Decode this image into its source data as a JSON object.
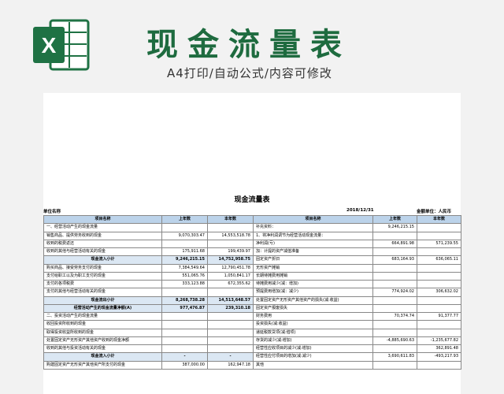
{
  "header": {
    "title": "现金流量表",
    "subtitle": "A4打印/自动公式/内容可修改",
    "icon_letter": "X"
  },
  "colors": {
    "brand": "#1e6b3f",
    "excel_green": "#1f7244",
    "table_header": "#bcd3ea"
  },
  "sheet": {
    "title": "现金流量表",
    "unit_label": "单位名称",
    "date": "2018/12/31",
    "currency": "金额单位：人民币",
    "columns": [
      "项目名称",
      "上年数",
      "本年数",
      "项目名称",
      "上年数",
      "本年数"
    ],
    "rows": [
      {
        "l": "一、经营活动产生的现金流量",
        "lp": "",
        "lc": "",
        "r": "补充资料：",
        "rp": "9,246,215.15",
        "rc": ""
      },
      {
        "l": "销售商品、提供劳务收到的现金",
        "lp": "9,070,303.47",
        "lc": "14,553,518.78",
        "r": "1、将净利润调节为经营活动现金流量：",
        "rp": "",
        "rc": ""
      },
      {
        "l": "收到的税费返还",
        "lp": "",
        "lc": "",
        "r": "净利润(亏)",
        "rp": "664,891.98",
        "rc": "571,239.55"
      },
      {
        "l": "收到的其他与经营活动有关的现金",
        "lp": "175,911.68",
        "lc": "199,439.97",
        "r": "加：计提的资产减值准备",
        "rp": "",
        "rc": ""
      },
      {
        "l": "现金流入小计",
        "lp": "9,246,215.15",
        "lc": "14,752,958.75",
        "r": "固定资产折旧",
        "rp": "683,164.93",
        "rc": "636,065.11",
        "sub": true
      },
      {
        "l": "购买商品、接受劳务支付的现金",
        "lp": "7,384,549.64",
        "lc": "12,790,451.78",
        "r": "无形资产摊销",
        "rp": "",
        "rc": ""
      },
      {
        "l": "支付给职工以及为职工支付的现金",
        "lp": "551,065.76",
        "lc": "1,050,841.17",
        "r": "长期待摊费用摊销",
        "rp": "",
        "rc": ""
      },
      {
        "l": "支付的各项税费",
        "lp": "333,123.88",
        "lc": "672,355.62",
        "r": "待摊费用减少(减：增加)",
        "rp": "",
        "rc": ""
      },
      {
        "l": "支付的其他与经营活动有关的现金",
        "lp": "",
        "lc": "",
        "r": "预提费用增加(减：减少)",
        "rp": "774,924.02",
        "rc": "306,632.02"
      },
      {
        "l": "现金流出小计",
        "lp": "8,268,738.28",
        "lc": "14,513,648.57",
        "r": "处置固定资产无形资产其他资产的损失(减:收益)",
        "rp": "",
        "rc": "",
        "sub": true
      },
      {
        "l": "经营活动产生的现金流量净额(A)",
        "lp": "977,476.87",
        "lc": "239,310.18",
        "r": "固定资产报废损失",
        "rp": "",
        "rc": "",
        "sub": true
      },
      {
        "l": "二、投资活动产生的现金流量",
        "lp": "",
        "lc": "",
        "r": "财务费用",
        "rp": "70,374.74",
        "rc": "91,377.77"
      },
      {
        "l": "收回投资所收到的现金",
        "lp": "",
        "lc": "",
        "r": "投资损失(减:收益)",
        "rp": "",
        "rc": ""
      },
      {
        "l": "取得投资收益所收到的现金",
        "lp": "",
        "lc": "",
        "r": "递延税款贷项(减:借项)",
        "rp": "",
        "rc": ""
      },
      {
        "l": "处置固定资产无形资产其他资产收到的现金净额",
        "lp": "",
        "lc": "",
        "r": "存货的减少(减:增加)",
        "rp": "-4,885,690.63",
        "rc": "-1,235,677.82"
      },
      {
        "l": "收到的其他与投资活动有关的现金",
        "lp": "",
        "lc": "",
        "r": "经营性应收项目的减少(减:增加)",
        "rp": "",
        "rc": "362,891.48"
      },
      {
        "l": "现金流入小计",
        "lp": "-",
        "lc": "-",
        "r": "经营性应付项目的增加(减:减少)",
        "rp": "3,690,611.83",
        "rc": "-493,217.93",
        "sub": true
      },
      {
        "l": "购建固定资产无形资产其他资产所支付的现金",
        "lp": "387,000.00",
        "lc": "162,947.18",
        "r": "其他",
        "rp": "",
        "rc": ""
      }
    ]
  }
}
